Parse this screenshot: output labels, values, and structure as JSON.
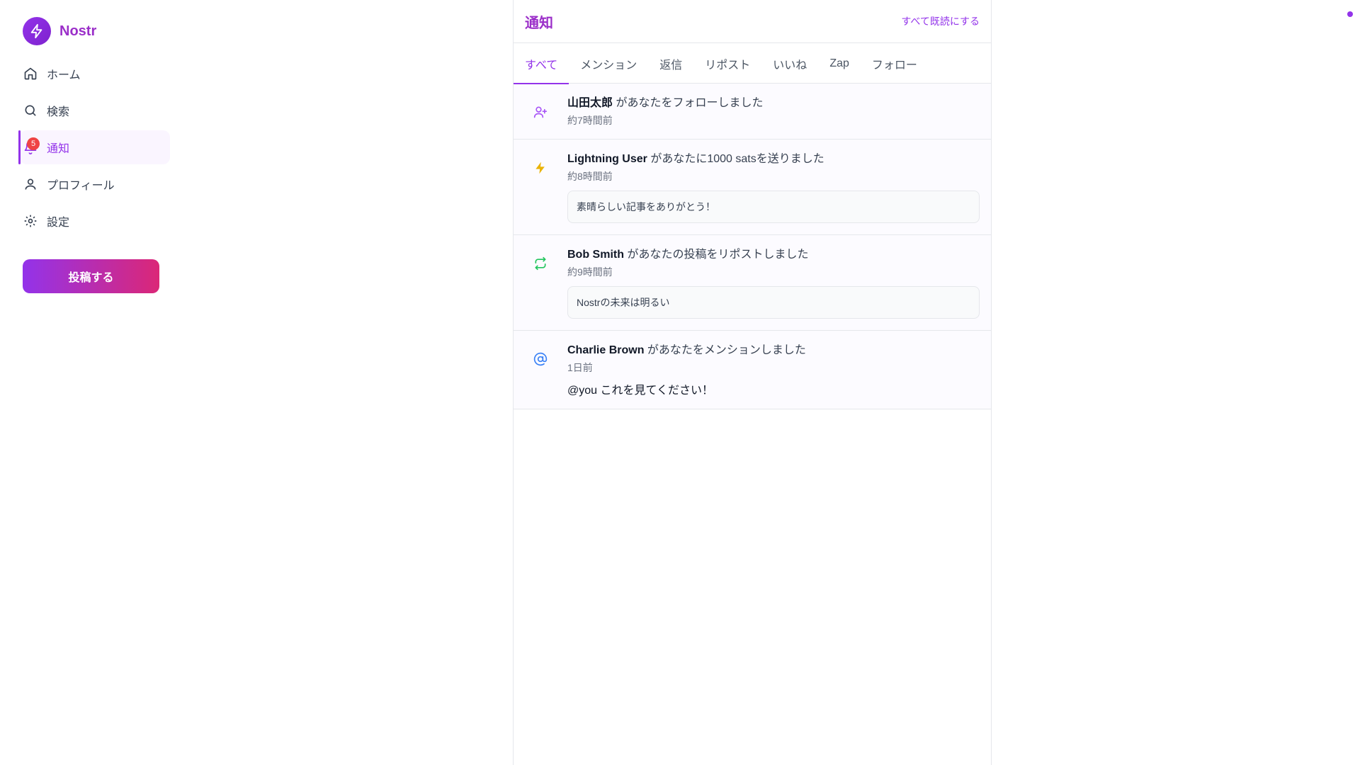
{
  "brand": {
    "name": "Nostr",
    "logo_icon": "bolt-icon",
    "accent": "#9333ea"
  },
  "sidebar": {
    "items": [
      {
        "label": "ホーム",
        "icon": "home-icon"
      },
      {
        "label": "検索",
        "icon": "search-icon"
      },
      {
        "label": "通知",
        "icon": "bell-icon",
        "badge": "5",
        "active": true
      },
      {
        "label": "プロフィール",
        "icon": "user-icon"
      },
      {
        "label": "設定",
        "icon": "gear-icon"
      }
    ],
    "post_button": "投稿する"
  },
  "header": {
    "title": "通知",
    "mark_all_read": "すべて既読にする"
  },
  "tabs": [
    {
      "label": "すべて",
      "active": true
    },
    {
      "label": "メンション"
    },
    {
      "label": "返信"
    },
    {
      "label": "リポスト"
    },
    {
      "label": "いいね"
    },
    {
      "label": "Zap"
    },
    {
      "label": "フォロー"
    }
  ],
  "notifications": [
    {
      "type": "follow",
      "icon": "user-plus-icon",
      "actor": "山田太郎",
      "action": "があなたをフォローしました",
      "time": "約7時間前"
    },
    {
      "type": "zap",
      "icon": "lightning-icon",
      "actor": "Lightning User",
      "action": "があなたに1000 satsを送りました",
      "time": "約8時間前",
      "quote": "素晴らしい記事をありがとう！"
    },
    {
      "type": "repost",
      "icon": "repost-icon",
      "actor": "Bob Smith",
      "action": "があなたの投稿をリポストしました",
      "time": "約9時間前",
      "quote": "Nostrの未来は明るい"
    },
    {
      "type": "mention",
      "icon": "at-icon",
      "actor": "Charlie Brown",
      "action": "があなたをメンションしました",
      "time": "1日前",
      "text": "@you これを見てください！"
    }
  ],
  "colors": {
    "follow": "#a855f7",
    "zap": "#eab308",
    "repost": "#22c55e",
    "mention": "#3b82f6",
    "badge": "#ef4444"
  }
}
